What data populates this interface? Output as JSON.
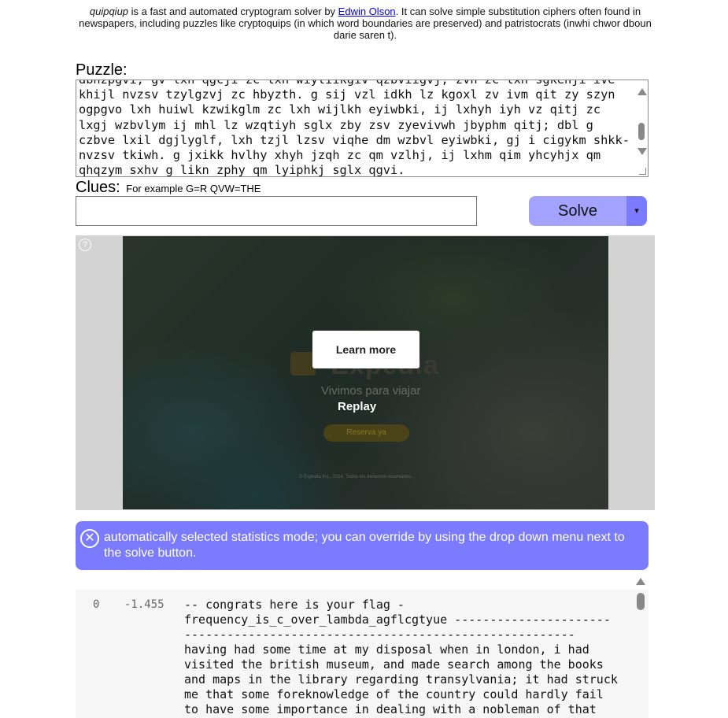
{
  "intro": {
    "brand": "quipqiup",
    "text_before_link": " is a fast and automated cryptogram solver by ",
    "author_link": "Edwin Olson",
    "text_after_link": ". It can solve simple substitution ciphers often found in newspapers, including puzzles like cryptoquips (in which word boundaries are preserved) and patristocrats (inwhi chwor dboun darie saren t)."
  },
  "puzzle": {
    "label": "Puzzle:",
    "text": "dbnzpgvi, gv lxh qgcji zc lxh wiyliikgiv qzbviigvj, zvh zc lxh sgkehji ive\nkhijl nvzsv tzylgzvj zc hbyzth. g sij vzl idkh lz kgoxl zv ivm qit zy szyn\nogpgvo lxh huiwl kzwikglm zc lxh wijlkh eyiwbki, ij lxhyh iyh vz qitj zc\nlxgj wzbvlym ij mhl lz wzqtiyh sglx zby zsv zyevivwh jbyphm qitj; dbl g\nczbve lxil dgjlyglf, lxh tzjl lzsv viqhe dm wzbvl eyiwbki, gj i cigykm shkk-\nnvzsv tkiwh. g jxikk hvlhy xhyh jzqh zc qm vzlhj, ij lxhm qim yhcyhjx qm\nqhqzym sxhv g likn zphy qm lyiphkj sglx qgvi."
  },
  "clues": {
    "label": "Clues:",
    "hint": "For example G=R QVW=THE",
    "value": ""
  },
  "solve": {
    "label": "Solve",
    "dropdown_glyph": "▾"
  },
  "ad": {
    "help_glyph": "?",
    "logo_text": "Expedia",
    "tagline": "Vivimos para viajar",
    "reserve_label": "Reserva ya",
    "copyright": "© Expedia Inc., 2024. Todos los derechos reservados.",
    "learn_more": "Learn more",
    "replay": "Replay"
  },
  "notice": {
    "icon_glyph": "✕",
    "text": "automatically selected statistics mode; you can override by using the drop down menu next to the solve button."
  },
  "results": {
    "rank": "0",
    "score": "-1.455",
    "text": "-- congrats here is your flag -\nfrequency_is_c_over_lambda_agflcgtyue ----------------------\n-------------------------------------------------------\nhaving had some time at my disposal when in london, i had\nvisited the british museum, and made search among the books\nand maps in the library regarding transylvania; it had struck\nme that some foreknowledge of the country could hardly fail\nto have some importance in dealing with a nobleman of that"
  },
  "colors": {
    "solve_button": "#a3a3ff",
    "solve_dropdown": "#7b7bff",
    "notice_bg": "#7b7bff",
    "ad_frame_bg": "#d3d3d3",
    "results_bg": "#f6f6f6"
  }
}
